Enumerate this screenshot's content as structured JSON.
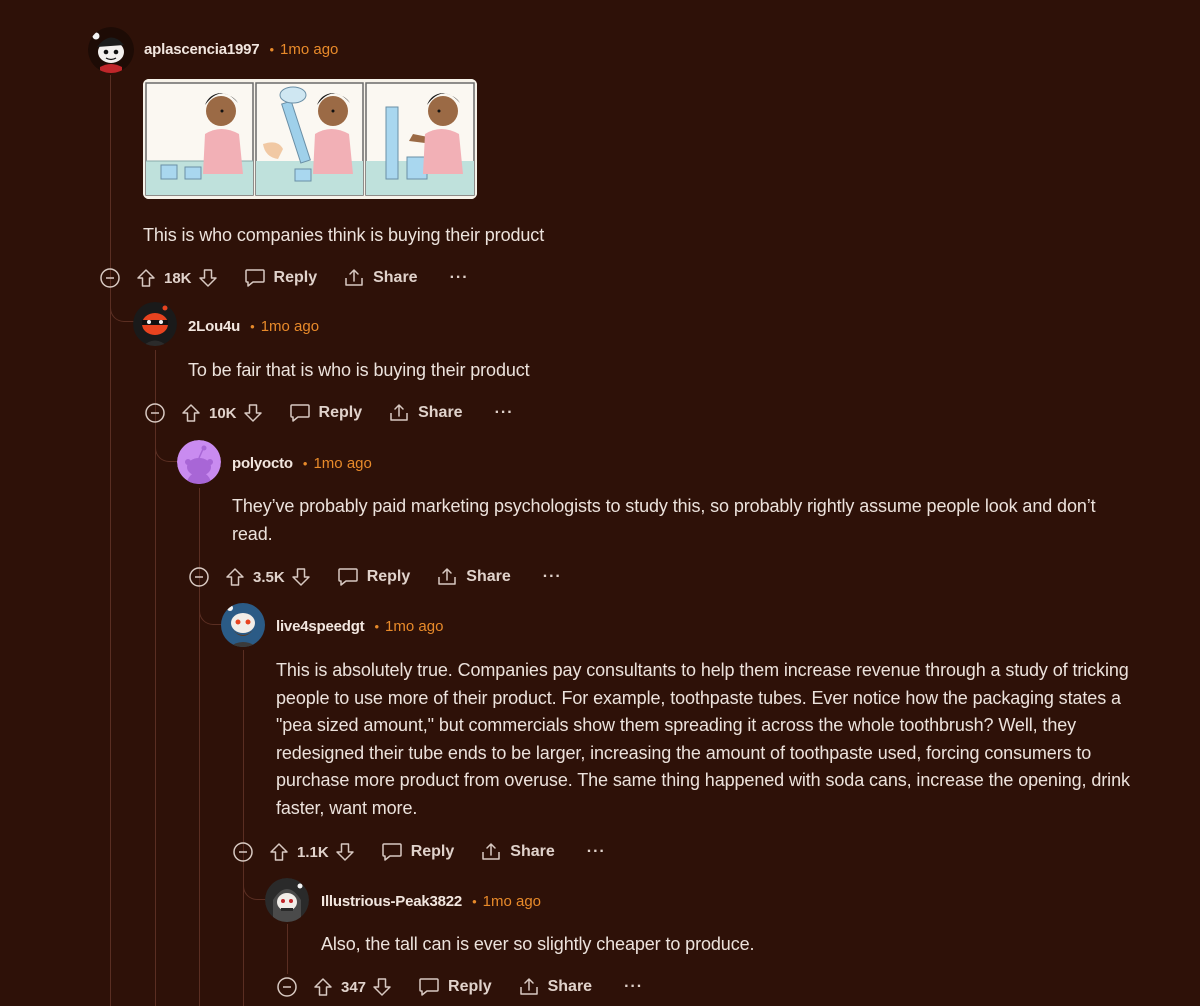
{
  "colors": {
    "background": "#2e1108",
    "thread_line": "#5a2e22",
    "timestamp": "#e88a2a",
    "text": "#ece2dc"
  },
  "comments": [
    {
      "username": "aplascencia1997",
      "time": "1mo ago",
      "text": "This is who companies think is buying their product",
      "score": "18K",
      "reply_label": "Reply",
      "share_label": "Share",
      "more_label": "···",
      "avatar_icon": "snoo-santa-hat-icon",
      "image": "three-panel-comic-child-looking-at-glasses-of-water"
    },
    {
      "username": "2Lou4u",
      "time": "1mo ago",
      "text": "To be fair that is who is buying their product",
      "score": "10K",
      "reply_label": "Reply",
      "share_label": "Share",
      "more_label": "···",
      "avatar_icon": "snoo-red-mask-icon"
    },
    {
      "username": "polyocto",
      "time": "1mo ago",
      "text": "They’ve probably paid marketing psychologists to study this, so probably rightly assume people look and don’t read.",
      "score": "3.5K",
      "reply_label": "Reply",
      "share_label": "Share",
      "more_label": "···",
      "avatar_icon": "snoo-default-purple-icon"
    },
    {
      "username": "live4speedgt",
      "time": "1mo ago",
      "text": "This is absolutely true. Companies pay consultants to help them increase revenue through a study of tricking people to use more of their product. For example, toothpaste tubes. Ever notice how the packaging states a \"pea sized amount,\" but commercials show them spreading it across the whole toothbrush? Well, they redesigned their tube ends to be larger, increasing the amount of toothpaste used, forcing consumers to purchase more product from overuse. The same thing happened with soda cans, increase the opening, drink faster, want more.",
      "score": "1.1K",
      "reply_label": "Reply",
      "share_label": "Share",
      "more_label": "···",
      "avatar_icon": "snoo-bearded-icon"
    },
    {
      "username": "Illustrious-Peak3822",
      "time": "1mo ago",
      "text": "Also, the tall can is ever so slightly cheaper to produce.",
      "score": "347",
      "reply_label": "Reply",
      "share_label": "Share",
      "more_label": "···",
      "avatar_icon": "snoo-hooded-icon"
    }
  ]
}
